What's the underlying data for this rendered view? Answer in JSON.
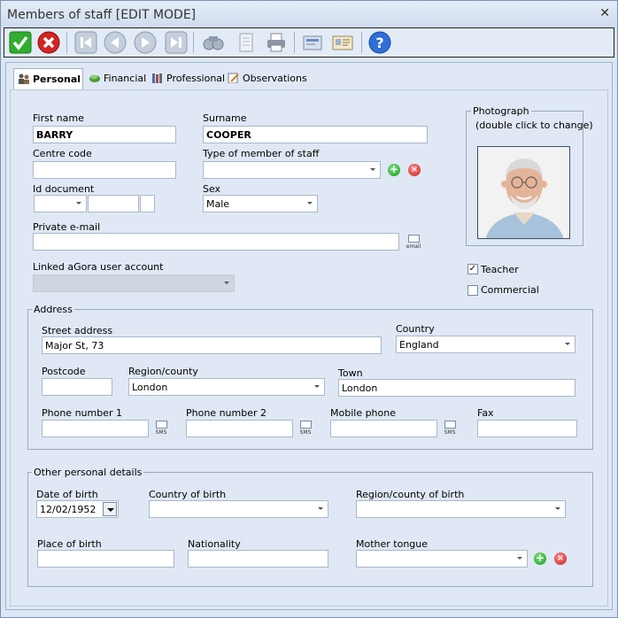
{
  "window": {
    "title": "Members of staff [EDIT MODE]",
    "close_glyph": "✕"
  },
  "toolbar": {
    "buttons": [
      "accept-icon",
      "cancel-icon",
      "first-record-icon",
      "previous-record-icon",
      "next-record-icon",
      "last-record-icon",
      "search-icon",
      "document-icon",
      "print-icon",
      "export-icon",
      "card-icon",
      "help-icon"
    ],
    "colors": {
      "accept": "#2fae2f",
      "cancel": "#d42323",
      "help": "#2f6fd6"
    }
  },
  "tabs": [
    {
      "label": "Personal",
      "icon": "people-icon",
      "active": true
    },
    {
      "label": "Financial",
      "icon": "money-icon",
      "active": false
    },
    {
      "label": "Professional",
      "icon": "books-icon",
      "active": false
    },
    {
      "label": "Observations",
      "icon": "notepad-icon",
      "active": false
    }
  ],
  "personal": {
    "first_name": {
      "label": "First name",
      "value": "BARRY"
    },
    "surname": {
      "label": "Surname",
      "value": "COOPER"
    },
    "centre_code": {
      "label": "Centre code",
      "value": ""
    },
    "type_member": {
      "label": "Type of member of staff",
      "value": ""
    },
    "id_document": {
      "label": "Id document",
      "value": ""
    },
    "sex": {
      "label": "Sex",
      "value": "Male"
    },
    "private_email": {
      "label": "Private e-mail",
      "value": "",
      "icon_text": "email"
    },
    "linked_account": {
      "label": "Linked aGora user account",
      "value": ""
    },
    "photograph": {
      "title": "Photograph",
      "hint": "(double click to change)"
    },
    "teacher": {
      "label": "Teacher",
      "checked": true,
      "mark": "✓"
    },
    "commercial": {
      "label": "Commercial",
      "checked": false
    }
  },
  "address": {
    "title": "Address",
    "street": {
      "label": "Street address",
      "value": "Major St, 73"
    },
    "country": {
      "label": "Country",
      "value": "England"
    },
    "postcode": {
      "label": "Postcode",
      "value": ""
    },
    "region": {
      "label": "Region/county",
      "value": "London"
    },
    "town": {
      "label": "Town",
      "value": "London"
    },
    "phone1": {
      "label": "Phone number 1",
      "value": "",
      "icon_text": "SMS"
    },
    "phone2": {
      "label": "Phone number 2",
      "value": "",
      "icon_text": "SMS"
    },
    "mobile": {
      "label": "Mobile phone",
      "value": "",
      "icon_text": "SMS"
    },
    "fax": {
      "label": "Fax",
      "value": ""
    }
  },
  "other": {
    "title": "Other personal details",
    "dob": {
      "label": "Date of birth",
      "value": "12/02/1952"
    },
    "country_birth": {
      "label": "Country of birth",
      "value": ""
    },
    "region_birth": {
      "label": "Region/county of birth",
      "value": ""
    },
    "place_birth": {
      "label": "Place of birth",
      "value": ""
    },
    "nationality": {
      "label": "Nationality",
      "value": ""
    },
    "mother_tongue": {
      "label": "Mother tongue",
      "value": ""
    }
  },
  "icons": {
    "add": "+",
    "delete": "×"
  }
}
